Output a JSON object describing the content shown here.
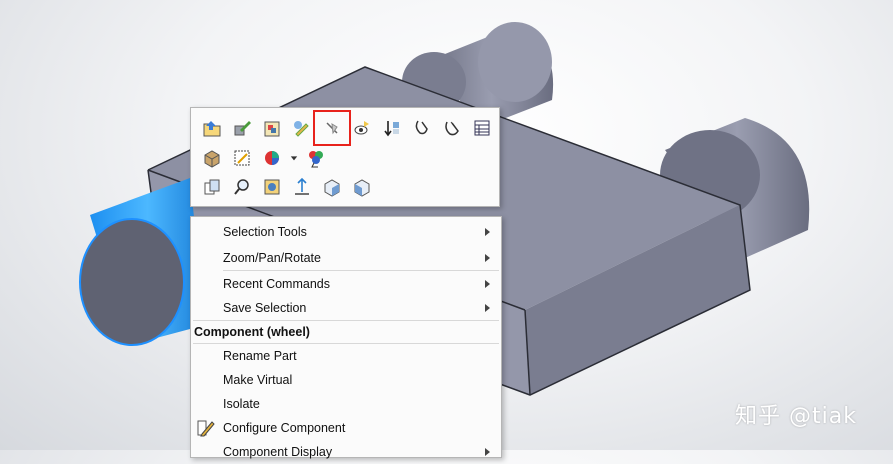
{
  "toolbar": {
    "rows": [
      [
        "open-part-icon",
        "edit-wrench-icon",
        "edit-assembly-icon",
        "hand-pencil-icon",
        "hide-components-icon",
        "show-hide-eye-icon",
        "stack-components-icon",
        "sort-down-icon",
        "paperclip-icon",
        "paperclip-dual-icon",
        "properties-table-icon"
      ],
      [
        "materials-cube-icon",
        "edit-sketch-icon",
        "appearance-sphere-icon",
        "dropdown-arrow-icon",
        "color-balls-icon"
      ],
      [
        "copy-icon",
        "zoom-magnifier-icon",
        "snapshot-icon",
        "normal-to-icon",
        "view-box-icon",
        "view-cube-icon"
      ]
    ],
    "highlighted": "hide-components-icon",
    "highlight_color": "#e8231c"
  },
  "context_menu": {
    "items": [
      {
        "label": "Selection Tools",
        "submenu": true
      },
      {
        "label": "Zoom/Pan/Rotate",
        "submenu": true
      },
      {
        "label": "Recent Commands",
        "submenu": true
      },
      {
        "label": "Save Selection",
        "submenu": true
      }
    ],
    "section_header": "Component (wheel)",
    "component_items": [
      {
        "label": "Rename Part"
      },
      {
        "label": "Make Virtual"
      },
      {
        "label": "Isolate"
      },
      {
        "label": "Configure Component",
        "icon": "configure-pencil-icon"
      },
      {
        "label": "Component Display",
        "submenu": true
      }
    ]
  },
  "watermark": "知乎 @tiak",
  "colors": {
    "model_face_top": "#8b8ea0",
    "model_face_side": "#6c6f82",
    "selected_edge": "#1e90ff",
    "selected_fill": "#2aa3f0"
  }
}
